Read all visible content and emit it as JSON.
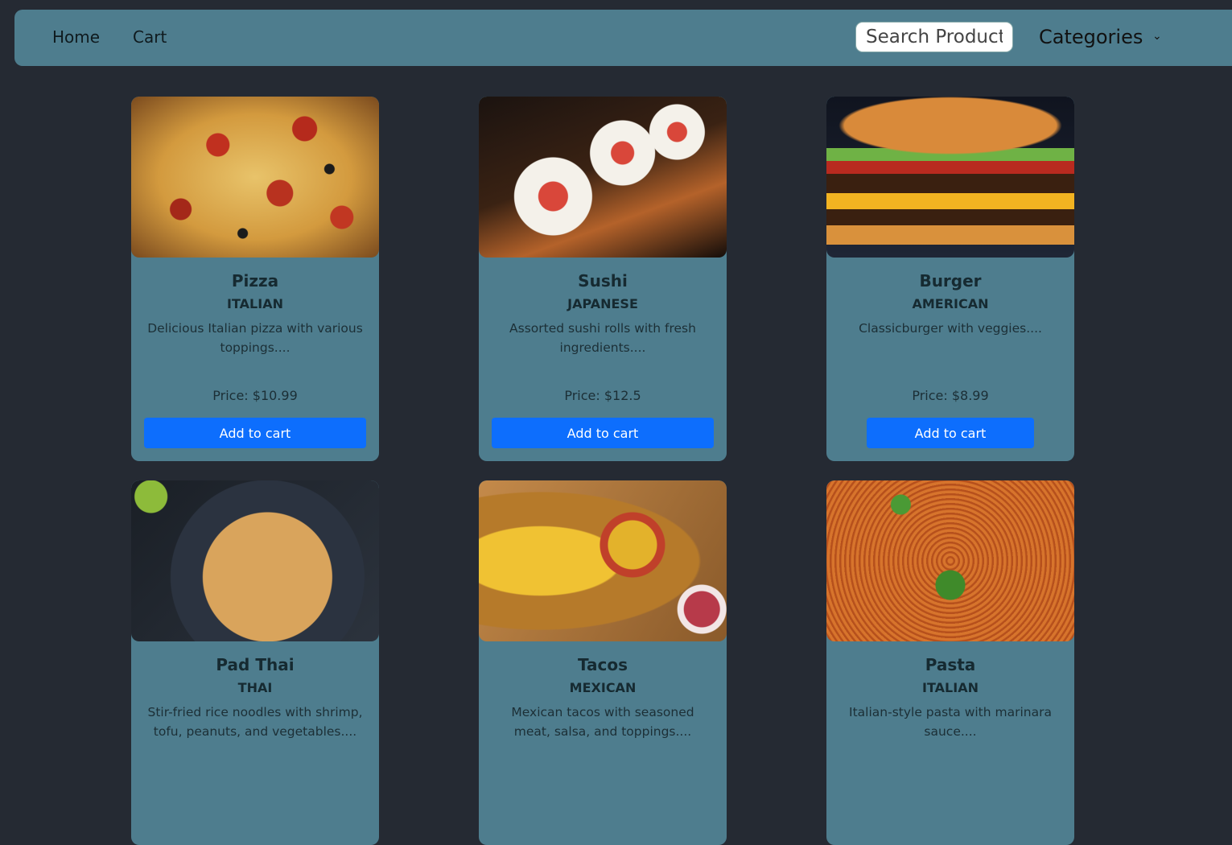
{
  "nav": {
    "home_label": "Home",
    "cart_label": "Cart",
    "search_placeholder": "Search Product",
    "categories_label": "Categories"
  },
  "products": [
    {
      "name": "Pizza",
      "cuisine": "ITALIAN",
      "description": "Delicious Italian pizza with various toppings....",
      "price": "Price: $10.99",
      "button": "Add to cart"
    },
    {
      "name": "Sushi",
      "cuisine": "JAPANESE",
      "description": "Assorted sushi rolls with fresh ingredients....",
      "price": "Price: $12.5",
      "button": "Add to cart"
    },
    {
      "name": "Burger",
      "cuisine": "AMERICAN",
      "description": "Classicburger with veggies....",
      "price": "Price: $8.99",
      "button": "Add to cart"
    },
    {
      "name": "Pad Thai",
      "cuisine": "THAI",
      "description": "Stir-fried rice noodles with shrimp, tofu, peanuts, and vegetables....",
      "price": "",
      "button": ""
    },
    {
      "name": "Tacos",
      "cuisine": "MEXICAN",
      "description": "Mexican tacos with seasoned meat, salsa, and toppings....",
      "price": "",
      "button": ""
    },
    {
      "name": "Pasta",
      "cuisine": "ITALIAN",
      "description": "Italian-style pasta with marinara sauce....",
      "price": "",
      "button": ""
    }
  ],
  "colors": {
    "background": "#252a33",
    "navbar": "#4e7d8e",
    "card": "#4e7d8e",
    "button": "#0d6efd"
  }
}
